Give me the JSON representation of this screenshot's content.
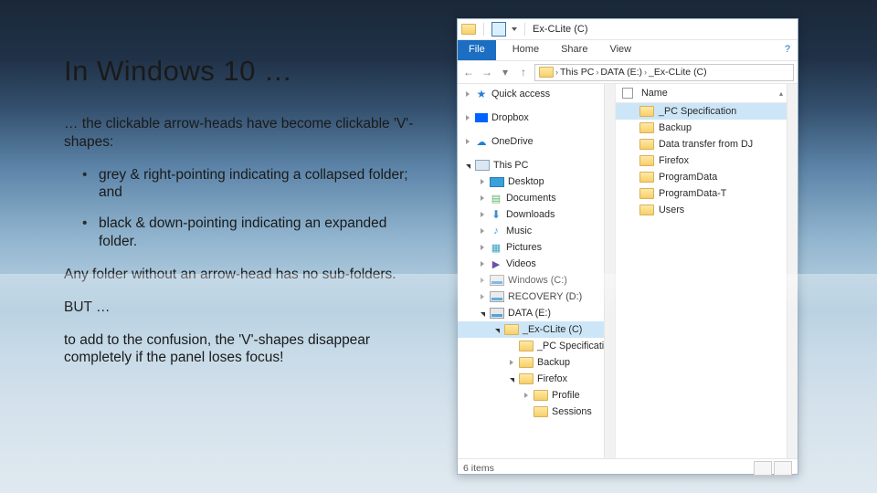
{
  "slide": {
    "title": "In Windows 10 …",
    "p1": "… the clickable arrow-heads have become clickable 'V'-shapes:",
    "bullets": [
      "grey & right-pointing indicating a collapsed folder; and",
      "black & down-pointing indicating an expanded folder."
    ],
    "p2": "Any folder without an arrow-head has no sub-folders.",
    "p3": "BUT …",
    "p4": "to add to the confusion, the 'V'-shapes disappear completely if the panel loses focus!"
  },
  "explorer": {
    "title": "Ex-CLite (C)",
    "ribbon": {
      "file": "File",
      "tabs": [
        "Home",
        "Share",
        "View"
      ]
    },
    "path": [
      "This PC",
      "DATA (E:)",
      "_Ex-CLite (C)"
    ],
    "nav": [
      {
        "label": "Quick access",
        "indent": 6,
        "twisty": "collapsed",
        "icon": "star"
      },
      {
        "label": "Dropbox",
        "indent": 6,
        "twisty": "collapsed",
        "icon": "dropbox"
      },
      {
        "label": "OneDrive",
        "indent": 6,
        "twisty": "collapsed",
        "icon": "onedrive"
      },
      {
        "label": "This PC",
        "indent": 6,
        "twisty": "expanded",
        "icon": "pc"
      },
      {
        "label": "Desktop",
        "indent": 22,
        "twisty": "collapsed",
        "icon": "desktop"
      },
      {
        "label": "Documents",
        "indent": 22,
        "twisty": "collapsed",
        "icon": "docs"
      },
      {
        "label": "Downloads",
        "indent": 22,
        "twisty": "collapsed",
        "icon": "dl"
      },
      {
        "label": "Music",
        "indent": 22,
        "twisty": "collapsed",
        "icon": "music"
      },
      {
        "label": "Pictures",
        "indent": 22,
        "twisty": "collapsed",
        "icon": "pic"
      },
      {
        "label": "Videos",
        "indent": 22,
        "twisty": "collapsed",
        "icon": "video"
      },
      {
        "label": "Windows (C:)",
        "indent": 22,
        "twisty": "collapsed",
        "icon": "drive"
      },
      {
        "label": "RECOVERY (D:)",
        "indent": 22,
        "twisty": "collapsed",
        "icon": "drive"
      },
      {
        "label": "DATA (E:)",
        "indent": 22,
        "twisty": "expanded",
        "icon": "drive"
      },
      {
        "label": "_Ex-CLite (C)",
        "indent": 38,
        "twisty": "expanded",
        "icon": "folder",
        "selected": true
      },
      {
        "label": "_PC Specification",
        "indent": 54,
        "twisty": "none",
        "icon": "folder"
      },
      {
        "label": "Backup",
        "indent": 54,
        "twisty": "collapsed",
        "icon": "folder"
      },
      {
        "label": "Firefox",
        "indent": 54,
        "twisty": "expanded",
        "icon": "folder"
      },
      {
        "label": "Profile",
        "indent": 70,
        "twisty": "collapsed",
        "icon": "folder"
      },
      {
        "label": "Sessions",
        "indent": 70,
        "twisty": "none",
        "icon": "folder"
      }
    ],
    "columns": {
      "name": "Name"
    },
    "items": [
      {
        "label": "_PC Specification",
        "selected": true
      },
      {
        "label": "Backup"
      },
      {
        "label": "Data transfer from DJ"
      },
      {
        "label": "Firefox"
      },
      {
        "label": "ProgramData"
      },
      {
        "label": "ProgramData-T"
      },
      {
        "label": "Users"
      }
    ],
    "status": "6 items"
  }
}
